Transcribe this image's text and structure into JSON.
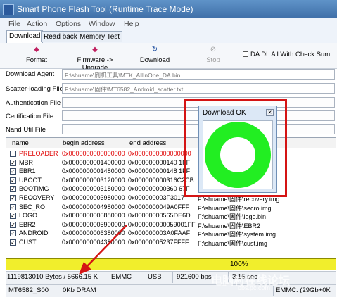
{
  "window": {
    "title": "Smart Phone Flash Tool (Runtime Trace Mode)"
  },
  "menu": [
    "File",
    "Action",
    "Options",
    "Window",
    "Help"
  ],
  "tabs": [
    "Download",
    "Read back",
    "Memory Test"
  ],
  "toolbar": {
    "format_label": "Format",
    "firmware_upgrade_label": "Firmware -> Upgrade",
    "download_label": "Download",
    "stop_label": "Stop",
    "da_dl_all_label": "DA DL All With Check Sum"
  },
  "fields": {
    "download_agent": {
      "label": "Download Agent",
      "value": "F:\\shuame\\刷机工具\\MTK_AllInOne_DA.bin"
    },
    "scatter_file": {
      "label": "Scatter-loading File",
      "value": "F:\\shuame\\固件\\MT6582_Android_scatter.txt"
    },
    "authentication": {
      "label": "Authentication File",
      "value": ""
    },
    "certification": {
      "label": "Certification File",
      "value": ""
    },
    "nand_util": {
      "label": "Nand Util File",
      "value": ""
    }
  },
  "table": {
    "headers": [
      "name",
      "begin address",
      "end address",
      ""
    ],
    "rows": [
      {
        "name": "PRELOADER",
        "begin": "0x0000000000000000",
        "end": "0x0000000000000000",
        "location": "",
        "checked": false,
        "error": true
      },
      {
        "name": "MBR",
        "begin": "0x0000000001400000",
        "end": "0x000000000140 1FF",
        "location": "",
        "checked": true,
        "error": false
      },
      {
        "name": "EBR1",
        "begin": "0x0000000001480000",
        "end": "0x000000000148 1FF",
        "location": "",
        "checked": true,
        "error": false
      },
      {
        "name": "UBOOT",
        "begin": "0x0000000003120000",
        "end": "0x000000000316C2CB",
        "location": "",
        "checked": true,
        "error": false
      },
      {
        "name": "BOOTIMG",
        "begin": "0x0000000003180000",
        "end": "0x000000000360 67F",
        "location": "",
        "checked": true,
        "error": false
      },
      {
        "name": "RECOVERY",
        "begin": "0x0000000003980000",
        "end": "0x000000003F3017",
        "location": "F:\\shuame\\固件\\recovery.img",
        "checked": true,
        "error": false
      },
      {
        "name": "SEC_RO",
        "begin": "0x0000000004980000",
        "end": "0x0000000049A0FFF",
        "location": "F:\\shuame\\固件\\secro.img",
        "checked": true,
        "error": false
      },
      {
        "name": "LOGO",
        "begin": "0x0000000005880000",
        "end": "0x00000000565DE6D",
        "location": "F:\\shuame\\固件\\logo.bin",
        "checked": true,
        "error": false
      },
      {
        "name": "EBR2",
        "begin": "0x0000000005900000",
        "end": "0x000000000059001FF",
        "location": "F:\\shuame\\固件\\EBR2",
        "checked": true,
        "error": false
      },
      {
        "name": "ANDROID",
        "begin": "0x0000000006380000",
        "end": "0x000000003A0FAAF",
        "location": "F:\\shuame\\固件\\system.img",
        "checked": true,
        "error": false
      },
      {
        "name": "CUST",
        "begin": "0x0000000004380000",
        "end": "0x00000005237FFFF",
        "location": "F:\\shuame\\固件\\cust.img",
        "checked": true,
        "error": false
      }
    ]
  },
  "progress": {
    "fraction": 1.0,
    "label": "100%",
    "color": "#f1ee2c"
  },
  "status": {
    "bytes": "1119813010 Bytes / 5666.15 K",
    "storage": "EMMC",
    "port": "USB",
    "baud": "921600 bps",
    "time": "3:15 sec",
    "chip": "MT6582_S00",
    "dram": "0Kb DRAM",
    "emmc": "EMMC: (29Gb+0K"
  },
  "dialog": {
    "title": "Download OK",
    "ring_color": "#22ee22"
  },
  "watermark": {
    "main": "电脑村在线论坛",
    "sub": "bbs.pc.com"
  }
}
